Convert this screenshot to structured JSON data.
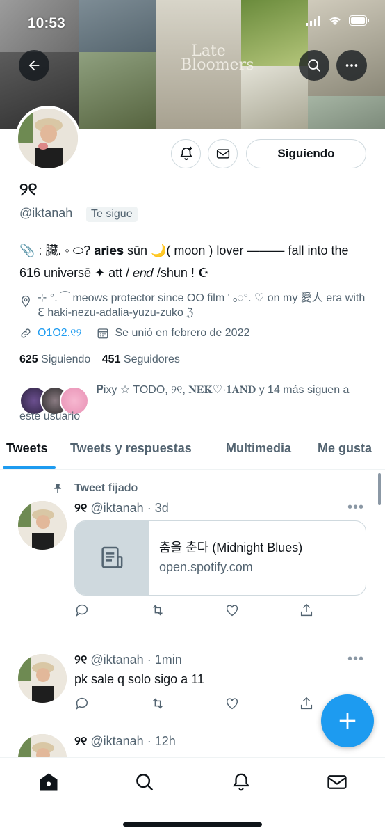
{
  "status_bar": {
    "time": "10:53"
  },
  "banner": {
    "overlay_text": "Late Bloomers"
  },
  "profile": {
    "name": "୨୧",
    "handle": "@iktanah",
    "follows_you": "Te sigue",
    "follow_button": "Siguiendo",
    "bio": "📎 : 臟. ◦ ⬭? 𝐚𝐫𝐢𝐞𝐬 sūn 🌙( moon ) lover ——— fall into the 616 univərsē ✦ att / 𝑒𝑛𝑑 /shun ! ☪",
    "location": "⊹ °. ⁀ meows protector since OO film ' ₒ◌°. ♡ on my 愛人 era with ℇ haki-nezu-adalia-yuzu-zuko ℨ",
    "website": "O1O2.୧୨",
    "joined": "Se unió en febrero de 2022",
    "following_count": "625",
    "following_label": "Siguiendo",
    "followers_count": "451",
    "followers_label": "Seguidores",
    "followed_by": "𝐏ixy ☆ TODO, ୨୧, 𝐍𝐄𝐊♡·𝟏𝐀𝐍𝐃 y 14 más siguen a este usuario"
  },
  "tabs": [
    "Tweets",
    "Tweets y respuestas",
    "Multimedia",
    "Me gusta"
  ],
  "tweets": [
    {
      "pinned_label": "Tweet fijado",
      "name": "୨୧",
      "handle": "@iktanah",
      "time": "· 3d",
      "card_title": "춤을 춘다 (Midnight Blues)",
      "card_url": "open.spotify.com"
    },
    {
      "name": "୨୧",
      "handle": "@iktanah",
      "time": "· 1min",
      "text": "pk sale q solo sigo a 11"
    },
    {
      "name": "୨୧",
      "handle": "@iktanah",
      "time": "· 12h"
    }
  ],
  "colors": {
    "accent": "#1d9bf0",
    "muted": "#536471",
    "text": "#0f1419"
  }
}
